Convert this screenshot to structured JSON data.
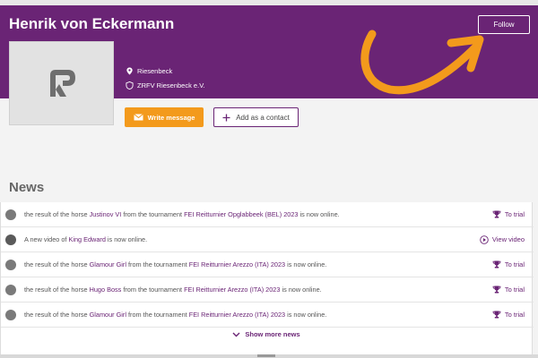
{
  "profile": {
    "name": "Henrik von Eckermann",
    "location": "Riesenbeck",
    "club": "ZRFV Riesenbeck e.V."
  },
  "actions": {
    "follow_label": "Follow",
    "write_label": "Write message",
    "contact_label": "Add as a contact"
  },
  "colors": {
    "banner": "#6a2475",
    "accent_orange": "#f39a1c",
    "link_purple": "#6a2475"
  },
  "news": {
    "title": "News",
    "items": [
      {
        "icon": "result-icon",
        "p1": "the result of the horse ",
        "horse": "Justinov VI",
        "p2": " from the tournament ",
        "tournament": "FEI Reitturnier Opglabbeek (BEL) 2023",
        "p3": " is now online.",
        "action_icon": "trophy-icon",
        "action": "To trial"
      },
      {
        "icon": "video-icon",
        "p1": "A new video of ",
        "horse": "King Edward",
        "p2": " is now online.",
        "tournament": "",
        "p3": "",
        "action_icon": "play-icon",
        "action": "View video"
      },
      {
        "icon": "result-icon",
        "p1": "the result of the horse ",
        "horse": "Glamour Girl",
        "p2": " from the tournament ",
        "tournament": "FEI Reitturnier Arezzo (ITA) 2023",
        "p3": " is now online.",
        "action_icon": "trophy-icon",
        "action": "To trial"
      },
      {
        "icon": "result-icon",
        "p1": "the result of the horse ",
        "horse": "Hugo Boss",
        "p2": " from the tournament ",
        "tournament": "FEI Reitturnier Arezzo (ITA) 2023",
        "p3": " is now online.",
        "action_icon": "trophy-icon",
        "action": "To trial"
      },
      {
        "icon": "result-icon",
        "p1": "the result of the horse ",
        "horse": "Glamour Girl",
        "p2": " from the tournament ",
        "tournament": "FEI Reitturnier Arezzo (ITA) 2023",
        "p3": " is now online.",
        "action_icon": "trophy-icon",
        "action": "To trial"
      }
    ],
    "show_more": "Show more news"
  }
}
